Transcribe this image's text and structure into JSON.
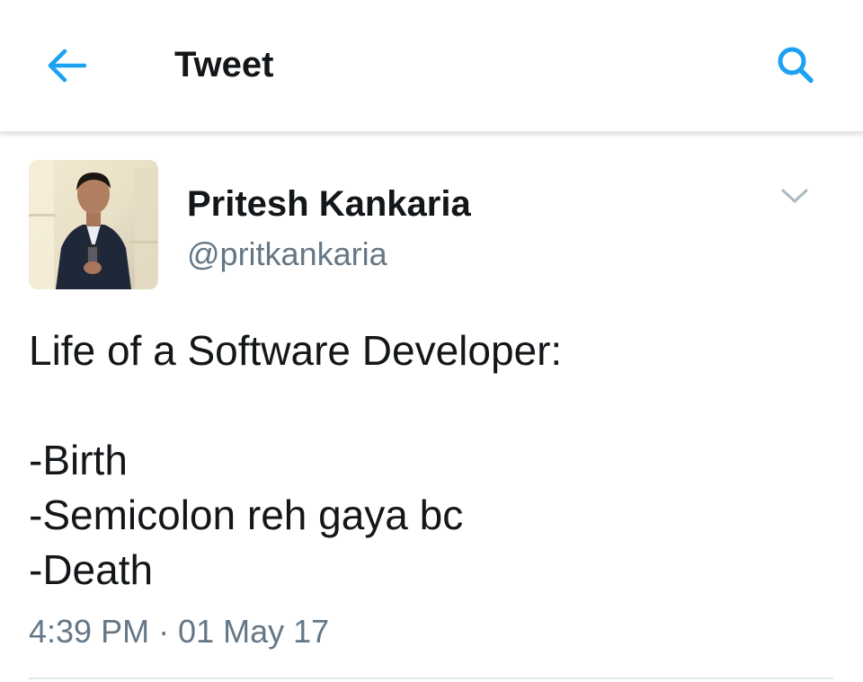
{
  "header": {
    "title": "Tweet",
    "back_icon": "arrow-left-icon",
    "search_icon": "search-icon",
    "accent_color": "#1da1f2"
  },
  "tweet": {
    "author": {
      "name": "Pritesh Kankaria",
      "handle": "@pritkankaria",
      "avatar": "profile-photo"
    },
    "menu_icon": "chevron-down-icon",
    "text_lines": [
      "Life of a Software Developer:",
      "",
      "-Birth",
      "-Semicolon reh gaya bc",
      "-Death"
    ],
    "timestamp": "4:39 PM · 01 May 17"
  }
}
